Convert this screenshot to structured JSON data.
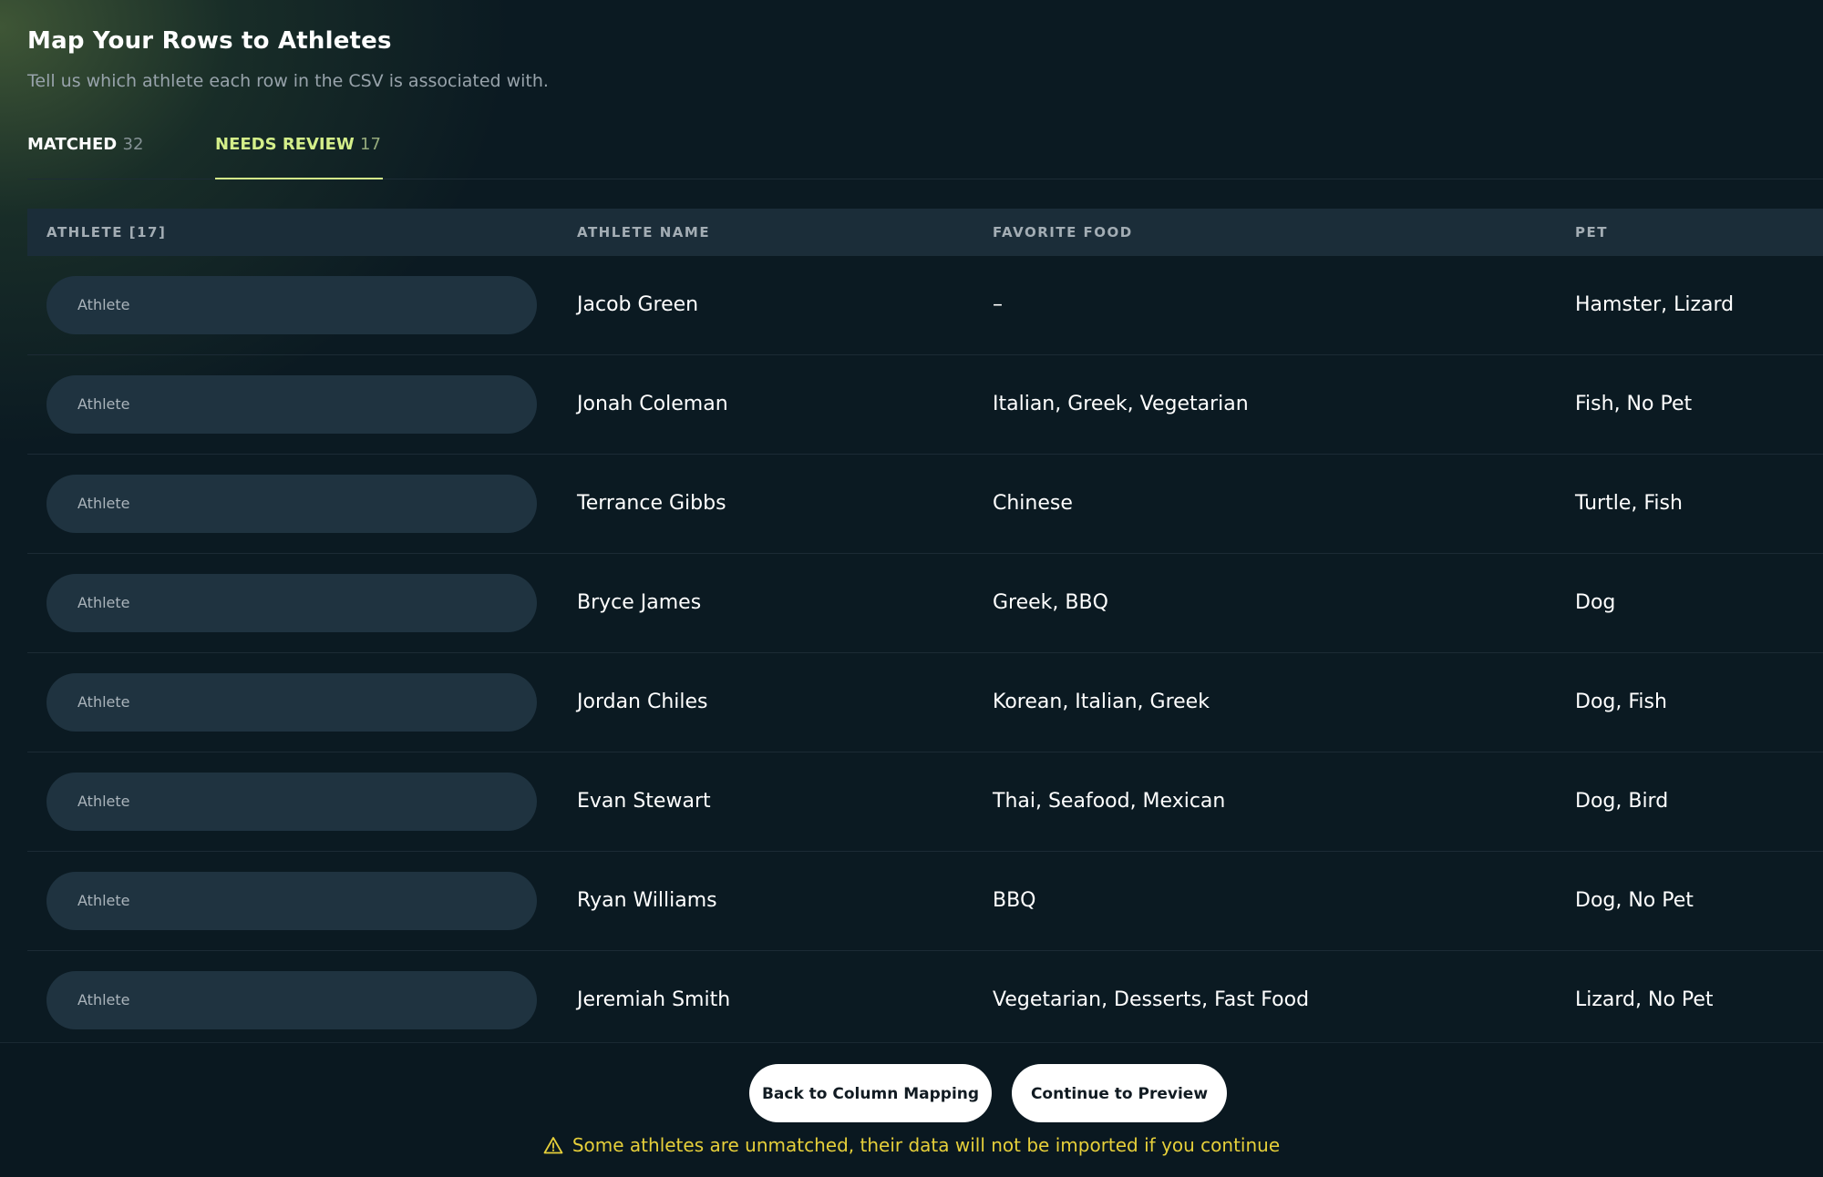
{
  "header": {
    "title": "Map Your Rows to Athletes",
    "subtitle": "Tell us which athlete each row in the CSV is associated with."
  },
  "tabs": [
    {
      "label": "MATCHED",
      "count": "32",
      "active": false
    },
    {
      "label": "NEEDS REVIEW",
      "count": "17",
      "active": true
    }
  ],
  "table": {
    "columns": [
      "ATHLETE [17]",
      "ATHLETE NAME",
      "FAVORITE FOOD",
      "PET"
    ],
    "select_placeholder": "Athlete",
    "rows": [
      {
        "name": "Jacob Green",
        "food": "–",
        "pet": "Hamster, Lizard"
      },
      {
        "name": "Jonah Coleman",
        "food": "Italian, Greek, Vegetarian",
        "pet": "Fish, No Pet"
      },
      {
        "name": "Terrance Gibbs",
        "food": "Chinese",
        "pet": "Turtle, Fish"
      },
      {
        "name": "Bryce James",
        "food": "Greek, BBQ",
        "pet": "Dog"
      },
      {
        "name": "Jordan Chiles",
        "food": "Korean, Italian, Greek",
        "pet": "Dog, Fish"
      },
      {
        "name": "Evan Stewart",
        "food": "Thai, Seafood, Mexican",
        "pet": "Dog, Bird"
      },
      {
        "name": "Ryan Williams",
        "food": "BBQ",
        "pet": "Dog, No Pet"
      },
      {
        "name": "Jeremiah Smith",
        "food": "Vegetarian, Desserts, Fast Food",
        "pet": "Lizard, No Pet"
      }
    ]
  },
  "footer": {
    "back_label": "Back to Column Mapping",
    "continue_label": "Continue to Preview",
    "warning_text": "Some athletes are unmatched, their data will not be imported if you continue",
    "warning_icon": "warning-triangle-icon"
  },
  "colors": {
    "background": "#0b1a22",
    "accent": "#d4ef8a",
    "warning": "#e6cf3a"
  }
}
